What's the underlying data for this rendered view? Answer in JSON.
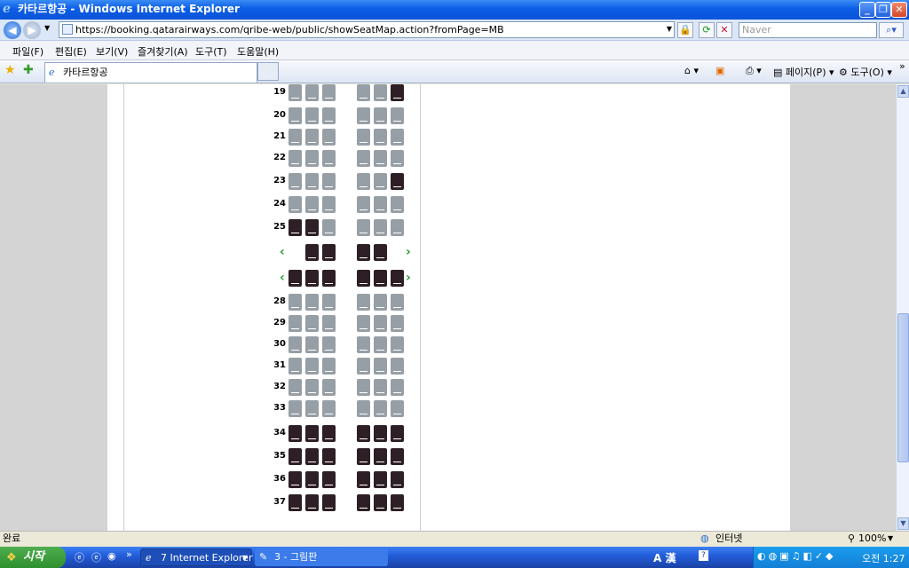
{
  "window": {
    "title": "카타르항공 - Windows Internet Explorer"
  },
  "address": {
    "url": "https://booking.qatarairways.com/qribe-web/public/showSeatMap.action?fromPage=MB",
    "search_placeholder": "Naver"
  },
  "menu": [
    "파일(F)",
    "편집(E)",
    "보기(V)",
    "즐겨찾기(A)",
    "도구(T)",
    "도움말(H)"
  ],
  "tab": {
    "label": "카타르항공"
  },
  "toolbar": {
    "page_label": "페이지(P)",
    "tools_label": "도구(O)"
  },
  "seatmap": {
    "rows": [
      {
        "label": "19",
        "seats": [
          "a",
          "a",
          "a",
          "a",
          "a",
          "o"
        ]
      },
      {
        "label": "20",
        "seats": [
          "a",
          "a",
          "a",
          "a",
          "a",
          "a"
        ]
      },
      {
        "label": "21",
        "seats": [
          "a",
          "a",
          "a",
          "a",
          "a",
          "a"
        ]
      },
      {
        "label": "22",
        "seats": [
          "a",
          "a",
          "a",
          "a",
          "a",
          "a"
        ]
      },
      {
        "label": "23",
        "seats": [
          "a",
          "a",
          "a",
          "a",
          "a",
          "o"
        ]
      },
      {
        "label": "24",
        "seats": [
          "a",
          "a",
          "a",
          "a",
          "a",
          "a"
        ]
      },
      {
        "label": "25",
        "seats": [
          "o",
          "o",
          "a",
          "a",
          "a",
          "a"
        ]
      },
      {
        "label": "",
        "seats": [
          "",
          "o",
          "o",
          "o",
          "o",
          ""
        ],
        "exit": true
      },
      {
        "label": "",
        "seats": [
          "o",
          "o",
          "o",
          "o",
          "o",
          "o"
        ],
        "exit": true
      },
      {
        "label": "28",
        "seats": [
          "a",
          "a",
          "a",
          "a",
          "a",
          "a"
        ]
      },
      {
        "label": "29",
        "seats": [
          "a",
          "a",
          "a",
          "a",
          "a",
          "a"
        ]
      },
      {
        "label": "30",
        "seats": [
          "a",
          "a",
          "a",
          "a",
          "a",
          "a"
        ]
      },
      {
        "label": "31",
        "seats": [
          "a",
          "a",
          "a",
          "a",
          "a",
          "a"
        ]
      },
      {
        "label": "32",
        "seats": [
          "a",
          "a",
          "a",
          "a",
          "a",
          "a"
        ]
      },
      {
        "label": "33",
        "seats": [
          "a",
          "a",
          "a",
          "a",
          "a",
          "a"
        ]
      },
      {
        "label": "34",
        "seats": [
          "o",
          "o",
          "o",
          "o",
          "o",
          "o"
        ]
      },
      {
        "label": "35",
        "seats": [
          "o",
          "o",
          "o",
          "o",
          "o",
          "o"
        ]
      },
      {
        "label": "36",
        "seats": [
          "o",
          "o",
          "o",
          "o",
          "o",
          "o"
        ]
      },
      {
        "label": "37",
        "seats": [
          "o",
          "o",
          "o",
          "o",
          "o",
          "o"
        ]
      }
    ]
  },
  "status": {
    "text": "완료",
    "zone": "인터넷",
    "zoom": "100%"
  },
  "taskbar": {
    "start": "시작",
    "items": [
      "7 Internet Explorer",
      "3 - 그림판"
    ],
    "clock": "오전 1:27",
    "lang": "A 漢"
  },
  "colors": {
    "seat_available": "#979fa6",
    "seat_occupied": "#2d1f25",
    "exit_arrow": "#2a9a2a"
  }
}
